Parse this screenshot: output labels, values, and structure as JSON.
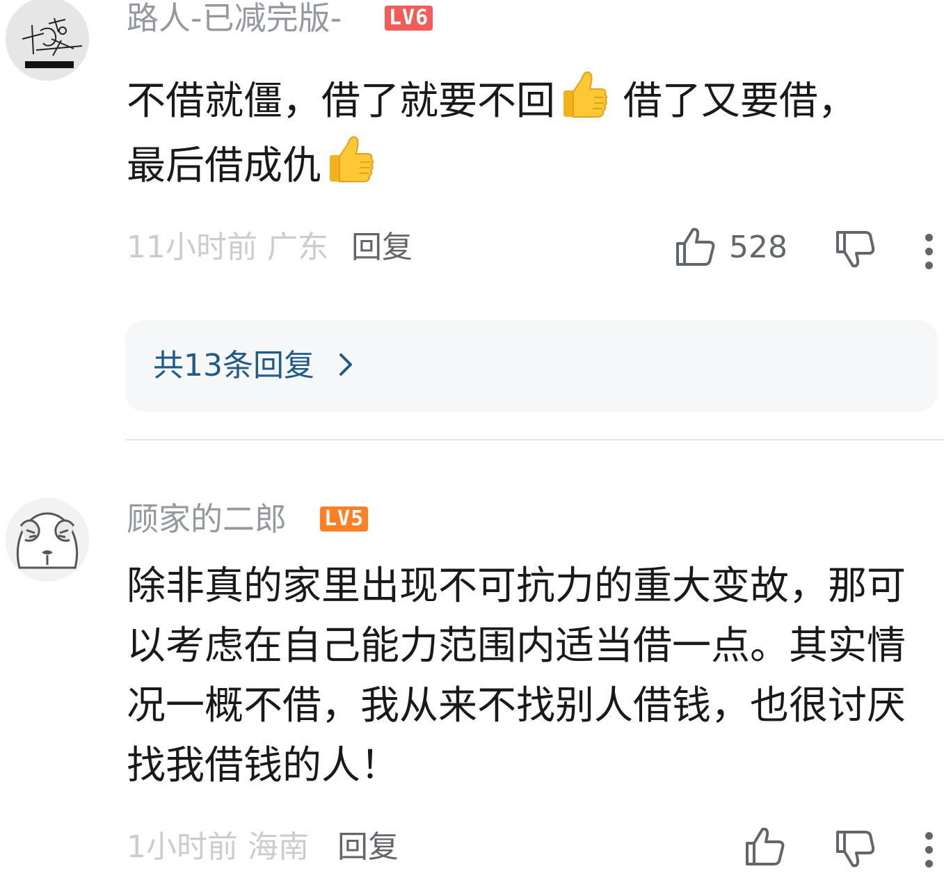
{
  "comments": [
    {
      "username": "路人-已减完版-",
      "level": "LV6",
      "level_color": "#f25d59",
      "avatar_icon": "signature-avatar",
      "text_line1": "不借就僵，借了就要不回",
      "text_line2": " 借了又要借，",
      "text_line3": "最后借成仇",
      "emoji": "thumbs-up-emoji",
      "time": "11小时前",
      "location": "广东",
      "reply_label": "回复",
      "likes": "528"
    },
    {
      "username": "顾家的二郎",
      "level": "LV5",
      "level_color": "#ff7f24",
      "avatar_icon": "cartoon-avatar",
      "text": "除非真的家里出现不可抗力的重大变故，那可以考虑在自己能力范围内适当借一点。其实情况一概不借，我从来不找别人借钱，也很讨厌找我借钱的人！",
      "time": "1小时前",
      "location": "海南",
      "reply_label": "回复",
      "likes": ""
    }
  ],
  "replies_summary": "共13条回复",
  "accent_color": "#1e5a8a"
}
